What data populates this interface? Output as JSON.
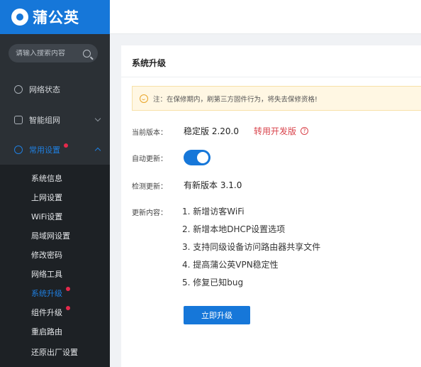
{
  "brand": {
    "name": "蒲公英"
  },
  "search": {
    "placeholder": "请输入搜索内容"
  },
  "sidebar": {
    "items": [
      {
        "label": "网络状态"
      },
      {
        "label": "智能组网"
      },
      {
        "label": "常用设置"
      }
    ],
    "submenu": [
      {
        "label": "系统信息"
      },
      {
        "label": "上网设置"
      },
      {
        "label": "WiFi设置"
      },
      {
        "label": "局域网设置"
      },
      {
        "label": "修改密码"
      },
      {
        "label": "网络工具"
      },
      {
        "label": "系统升级"
      },
      {
        "label": "组件升级"
      },
      {
        "label": "重启路由"
      },
      {
        "label": "还原出厂设置"
      }
    ]
  },
  "panel": {
    "title": "系统升级",
    "notice": "注：在保修期内，刷第三方固件行为，将失去保修资格!",
    "current_version_label": "当前版本：",
    "current_version_value": "稳定版  2.20.0",
    "switch_link": "转用开发版",
    "help_glyph": "?",
    "auto_update_label": "自动更新：",
    "auto_update_on": true,
    "check_update_label": "检测更新：",
    "check_update_value": "有新版本    3.1.0",
    "changelog_label": "更新内容：",
    "changelog": [
      "1. 新增访客WiFi",
      "2. 新增本地DHCP设置选项",
      "3. 支持同级设备访问路由器共享文件",
      "4. 提高蒲公英VPN稳定性",
      "5. 修复已知bug"
    ],
    "upgrade_button": "立即升级"
  },
  "colors": {
    "accent": "#1677d9",
    "sidebar_bg": "#2b3035",
    "submenu_bg": "#1d2125",
    "link_red": "#d9434b",
    "notice_bg": "#fff7e3"
  }
}
